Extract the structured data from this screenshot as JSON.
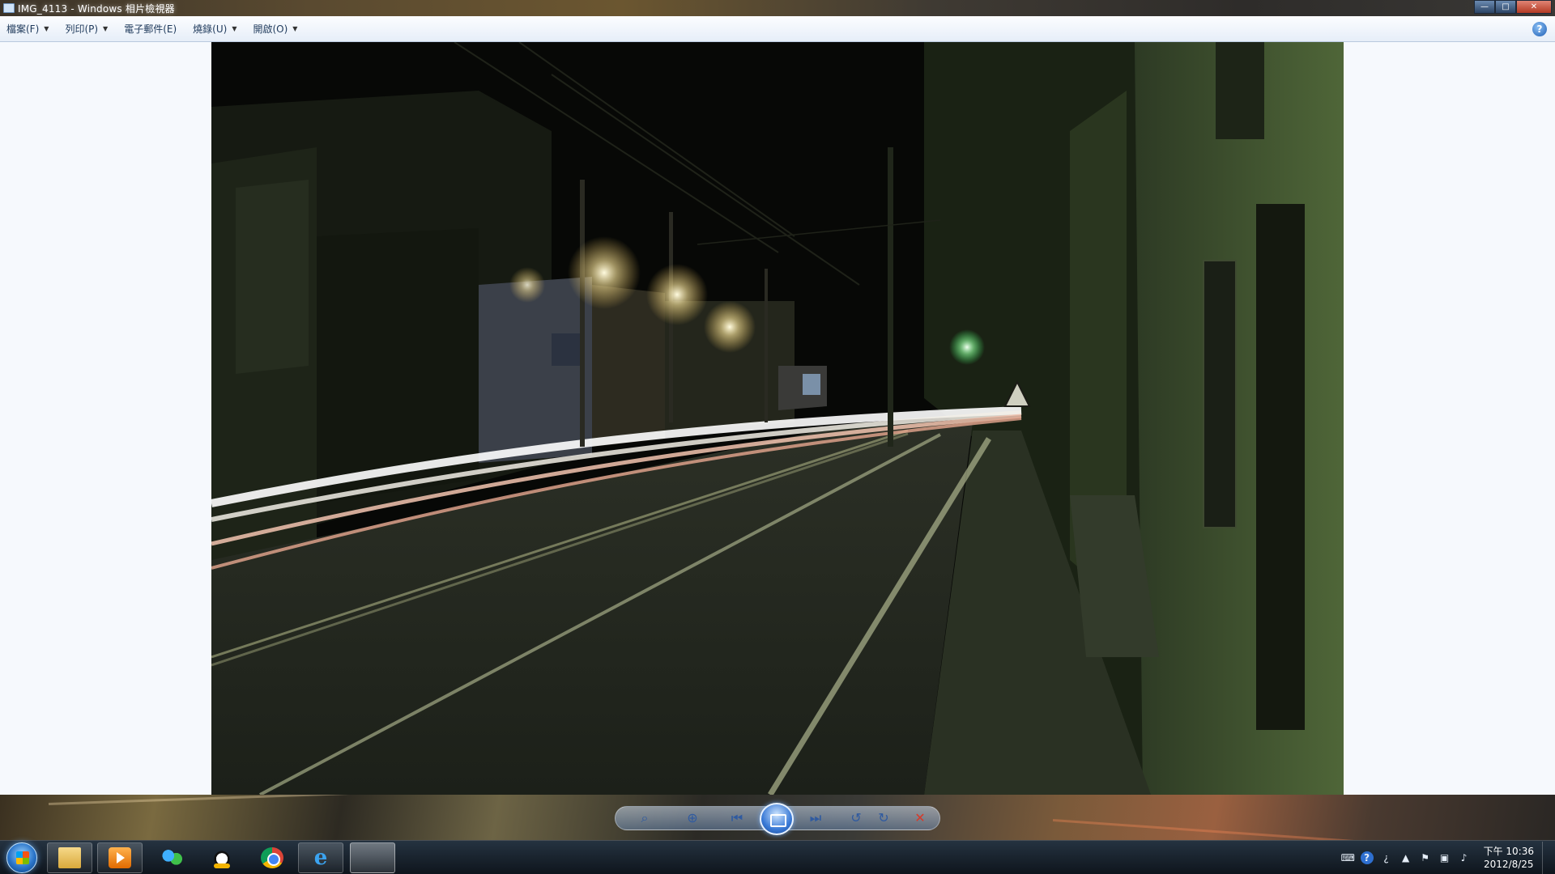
{
  "window": {
    "title": "IMG_4113 - Windows 相片檢視器",
    "controls": {
      "minimize": "—",
      "maximize": "□",
      "close": "✕"
    }
  },
  "menu": {
    "items": [
      {
        "label": "檔案(F)",
        "icon": "caret-down-icon"
      },
      {
        "label": "列印(P)",
        "icon": "caret-down-icon"
      },
      {
        "label": "電子郵件(E)"
      },
      {
        "label": "燒錄(U)",
        "icon": "caret-down-icon"
      },
      {
        "label": "開啟(O)",
        "icon": "caret-down-icon"
      }
    ],
    "help_icon": "?"
  },
  "controls": {
    "zoom": "zoom-icon",
    "actual_size": "actual-size-icon",
    "previous": "previous-icon",
    "slideshow": "slideshow-icon",
    "next": "next-icon",
    "rotate_left": "rotate-ccw-icon",
    "rotate_right": "rotate-cw-icon",
    "delete": "delete-icon"
  },
  "taskbar": {
    "apps": [
      {
        "name": "windows-explorer",
        "icon": "folder-icon"
      },
      {
        "name": "media-player",
        "icon": "media-player-icon"
      },
      {
        "name": "messenger",
        "icon": "people-icon"
      },
      {
        "name": "qq",
        "icon": "penguin-icon"
      },
      {
        "name": "chrome",
        "icon": "chrome-icon"
      },
      {
        "name": "internet-explorer",
        "icon": "ie-icon",
        "glyph": "e"
      },
      {
        "name": "photo-viewer",
        "icon": "photo-viewer-icon"
      }
    ],
    "clock": {
      "time": "下午 10:36",
      "date": "2012/8/25"
    }
  }
}
